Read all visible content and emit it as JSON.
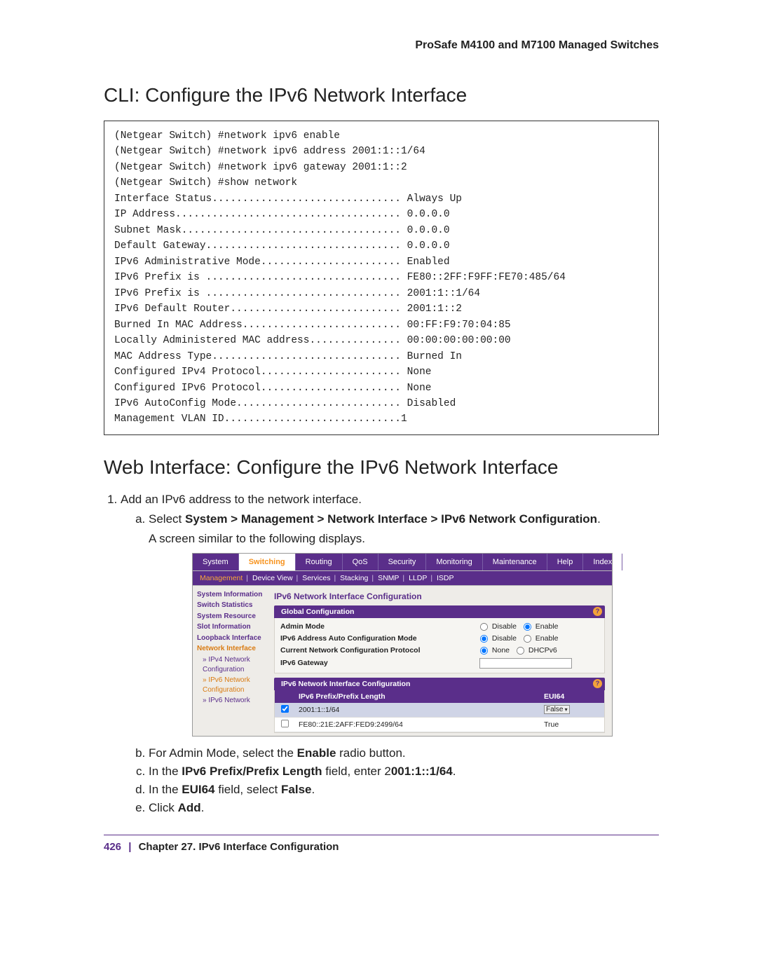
{
  "doc": {
    "product_line": "ProSafe M4100 and M7100 Managed Switches"
  },
  "section1": {
    "heading": "CLI: Configure the IPv6 Network Interface",
    "cli": "(Netgear Switch) #network ipv6 enable\n(Netgear Switch) #network ipv6 address 2001:1::1/64\n(Netgear Switch) #network ipv6 gateway 2001:1::2\n(Netgear Switch) #show network\nInterface Status............................... Always Up\nIP Address..................................... 0.0.0.0\nSubnet Mask.................................... 0.0.0.0\nDefault Gateway................................ 0.0.0.0\nIPv6 Administrative Mode....................... Enabled\nIPv6 Prefix is ................................ FE80::2FF:F9FF:FE70:485/64\nIPv6 Prefix is ................................ 2001:1::1/64\nIPv6 Default Router............................ 2001:1::2\nBurned In MAC Address.......................... 00:FF:F9:70:04:85\nLocally Administered MAC address............... 00:00:00:00:00:00\nMAC Address Type............................... Burned In\nConfigured IPv4 Protocol....................... None\nConfigured IPv6 Protocol....................... None\nIPv6 AutoConfig Mode........................... Disabled\nManagement VLAN ID.............................1"
  },
  "section2": {
    "heading": "Web Interface: Configure the IPv6 Network Interface",
    "step1": "Add an IPv6 address to the network interface.",
    "sub_a_pre": "Select ",
    "sub_a_bold": "System > Management > Network Interface > IPv6 Network Configuration",
    "sub_a_post": ".",
    "sub_a_line2": "A screen similar to the following displays.",
    "sub_b_pre": "For Admin Mode, select the ",
    "sub_b_bold": "Enable",
    "sub_b_post": " radio button.",
    "sub_c_pre": "In the ",
    "sub_c_bold1": "IPv6 Prefix/Prefix Length",
    "sub_c_mid": " field, enter 2",
    "sub_c_bold2": "001:1::1/64",
    "sub_c_post": ".",
    "sub_d_pre": "In the ",
    "sub_d_bold": "EUI64",
    "sub_d_mid": " field, select ",
    "sub_d_bold2": "False",
    "sub_d_post": ".",
    "sub_e_pre": "Click ",
    "sub_e_bold": "Add",
    "sub_e_post": "."
  },
  "ui": {
    "top_tabs": [
      "System",
      "Switching",
      "Routing",
      "QoS",
      "Security",
      "Monitoring",
      "Maintenance",
      "Help",
      "Index"
    ],
    "sub_tabs": [
      "Management",
      "Device View",
      "Services",
      "Stacking",
      "SNMP",
      "LLDP",
      "ISDP"
    ],
    "sidebar": {
      "items": [
        "System Information",
        "Switch Statistics",
        "System Resource",
        "Slot Information",
        "Loopback Interface",
        "Network Interface"
      ],
      "subs": [
        "IPv4 Network Configuration",
        "IPv6 Network Configuration",
        "IPv6 Network"
      ]
    },
    "panel_title": "IPv6 Network Interface Configuration",
    "group1_title": "Global Configuration",
    "rows": {
      "admin_mode": "Admin Mode",
      "auto_mode": "IPv6 Address Auto Configuration Mode",
      "protocol": "Current Network Configuration Protocol",
      "gateway": "IPv6 Gateway",
      "disable": "Disable",
      "enable": "Enable",
      "none": "None",
      "dhcpv6": "DHCPv6"
    },
    "group2_title": "IPv6 Network Interface Configuration",
    "table": {
      "col1": "IPv6 Prefix/Prefix Length",
      "col2": "EUI64",
      "r1_prefix": "2001:1::1/64",
      "r1_eui": "False",
      "r2_prefix": "FE80::21E:2AFF:FED9:2499/64",
      "r2_eui": "True"
    }
  },
  "footer": {
    "page": "426",
    "chapter": "Chapter 27.  IPv6 Interface Configuration"
  }
}
